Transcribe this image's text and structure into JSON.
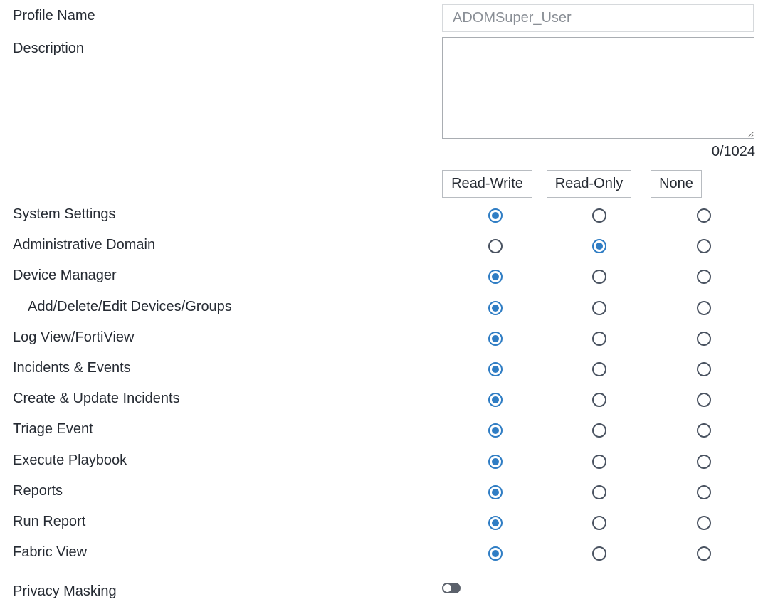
{
  "profile_name": {
    "label": "Profile Name",
    "value": "ADOMSuper_User"
  },
  "description": {
    "label": "Description",
    "value": "",
    "counter": "0/1024"
  },
  "columns": [
    "Read-Write",
    "Read-Only",
    "None"
  ],
  "permissions": [
    {
      "label": "System Settings",
      "selected": "Read-Write",
      "indent": false
    },
    {
      "label": "Administrative Domain",
      "selected": "Read-Only",
      "indent": false
    },
    {
      "label": "Device Manager",
      "selected": "Read-Write",
      "indent": false
    },
    {
      "label": "Add/Delete/Edit Devices/Groups",
      "selected": "Read-Write",
      "indent": true
    },
    {
      "label": "Log View/FortiView",
      "selected": "Read-Write",
      "indent": false
    },
    {
      "label": "Incidents & Events",
      "selected": "Read-Write",
      "indent": false
    },
    {
      "label": "Create & Update Incidents",
      "selected": "Read-Write",
      "indent": false
    },
    {
      "label": "Triage Event",
      "selected": "Read-Write",
      "indent": false
    },
    {
      "label": "Execute Playbook",
      "selected": "Read-Write",
      "indent": false
    },
    {
      "label": "Reports",
      "selected": "Read-Write",
      "indent": false
    },
    {
      "label": "Run Report",
      "selected": "Read-Write",
      "indent": false
    },
    {
      "label": "Fabric View",
      "selected": "Read-Write",
      "indent": false
    }
  ],
  "privacy_masking": {
    "label": "Privacy Masking",
    "enabled": false
  },
  "colors": {
    "accent": "#2f7dc4",
    "text": "#262b33",
    "toggle_off": "#5b616b"
  }
}
